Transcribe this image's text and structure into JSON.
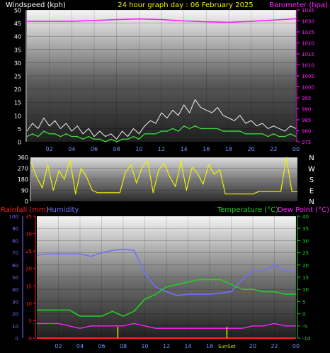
{
  "header": {
    "left_label": "Windspeed (kph)",
    "title": "24 hour graph day : 06 February 2025",
    "right_label": "Barometer (hpa)"
  },
  "colors": {
    "wind_avg": "#3ad53a",
    "wind_gust": "#f0f0f0",
    "barometer": "#ff20ff",
    "wind_dir": "#f0f000",
    "rainfall": "#ff2020",
    "humidity": "#7070ff",
    "temperature": "#20d020",
    "dewpoint": "#ff20ff",
    "sun_marker": "#e0e000",
    "background": "#000000"
  },
  "time_axis": {
    "ticks": [
      "02",
      "04",
      "06",
      "08",
      "10",
      "12",
      "14",
      "16",
      "18",
      "20",
      "22",
      "00"
    ]
  },
  "bottom_header": {
    "rainfall_label": "Rainfall (mm)",
    "humidity_label": "Humidity",
    "temperature_label": "Temperature (°C)",
    "dewpoint_label": "Dew Point (°C)",
    "sunset_label": "SunSet"
  },
  "compass": [
    "N",
    "W",
    "S",
    "E",
    "N"
  ],
  "chart_data": [
    {
      "type": "line",
      "title": "24 hour graph day : 06 February 2025",
      "x_unit": "hours",
      "xlim": [
        0,
        24
      ],
      "y_left": {
        "label": "Windspeed (kph)",
        "ylim": [
          0,
          50
        ],
        "ticks": [
          "0",
          "5",
          "10",
          "15",
          "20",
          "25",
          "30",
          "35",
          "40",
          "45",
          "50"
        ]
      },
      "y_right": {
        "label": "Barometer (hpa)",
        "ylim": [
          975,
          1035
        ],
        "ticks": [
          "975",
          "980",
          "985",
          "990",
          "995",
          "1000",
          "1005",
          "1010",
          "1015",
          "1020",
          "1025",
          "1030",
          "1035"
        ]
      },
      "series": [
        {
          "name": "Wind gust",
          "axis": "left",
          "x": [
            0,
            0.5,
            1,
            1.5,
            2,
            2.5,
            3,
            3.5,
            4,
            4.5,
            5,
            5.5,
            6,
            6.5,
            7,
            7.5,
            8,
            8.5,
            9,
            9.5,
            10,
            10.5,
            11,
            11.5,
            12,
            12.5,
            13,
            13.5,
            14,
            14.5,
            15,
            15.5,
            16,
            16.5,
            17,
            17.5,
            18,
            18.5,
            19,
            19.5,
            20,
            20.5,
            21,
            21.5,
            22,
            22.5,
            23,
            23.5,
            24
          ],
          "values": [
            4,
            7,
            5,
            9,
            6,
            8,
            5,
            7,
            4,
            6,
            3,
            5,
            2,
            4,
            2,
            3,
            1,
            4,
            2,
            5,
            3,
            6,
            8,
            7,
            11,
            9,
            12,
            10,
            14,
            11,
            16,
            13,
            12,
            11,
            13,
            10,
            9,
            8,
            10,
            7,
            8,
            6,
            7,
            5,
            6,
            5,
            4,
            6,
            5
          ]
        },
        {
          "name": "Wind speed",
          "axis": "left",
          "x": [
            0,
            0.5,
            1,
            1.5,
            2,
            2.5,
            3,
            3.5,
            4,
            4.5,
            5,
            5.5,
            6,
            6.5,
            7,
            7.5,
            8,
            8.5,
            9,
            9.5,
            10,
            10.5,
            11,
            11.5,
            12,
            12.5,
            13,
            13.5,
            14,
            14.5,
            15,
            15.5,
            16,
            16.5,
            17,
            17.5,
            18,
            18.5,
            19,
            19.5,
            20,
            20.5,
            21,
            21.5,
            22,
            22.5,
            23,
            23.5,
            24
          ],
          "values": [
            2,
            3,
            2,
            4,
            3,
            3,
            2,
            3,
            2,
            2,
            1,
            2,
            1,
            1,
            0,
            1,
            0,
            1,
            1,
            2,
            1,
            3,
            3,
            3,
            4,
            4,
            5,
            4,
            6,
            5,
            6,
            5,
            5,
            5,
            5,
            4,
            4,
            4,
            4,
            3,
            3,
            3,
            3,
            2,
            3,
            2,
            2,
            3,
            2
          ]
        },
        {
          "name": "Barometer",
          "axis": "right",
          "x": [
            0,
            2,
            4,
            6,
            8,
            10,
            12,
            14,
            16,
            18,
            20,
            22,
            24
          ],
          "values": [
            1029.8,
            1029.8,
            1029.8,
            1030.2,
            1030.6,
            1030.9,
            1030.6,
            1030.0,
            1029.6,
            1029.4,
            1029.8,
            1030.4,
            1031.0
          ]
        }
      ]
    },
    {
      "type": "scatter",
      "title": "",
      "x_unit": "hours",
      "xlim": [
        0,
        24
      ],
      "ylim": [
        0,
        360
      ],
      "y_ticks": [
        "0",
        "90",
        "180",
        "270",
        "360"
      ],
      "series": [
        {
          "name": "Wind direction",
          "x": [
            0,
            0.5,
            1,
            1.5,
            2,
            2.5,
            3,
            3.5,
            4,
            4.5,
            5,
            5.5,
            6,
            6.5,
            7,
            7.5,
            8,
            8.5,
            9,
            9.5,
            10,
            10.5,
            11,
            11.5,
            12,
            12.5,
            13,
            13.5,
            14,
            14.5,
            15,
            15.5,
            16,
            16.5,
            17,
            17.5,
            18,
            18.5,
            19,
            19.5,
            20,
            20.5,
            21,
            21.5,
            22,
            22.5,
            23,
            23.5,
            24
          ],
          "values": [
            320,
            200,
            110,
            300,
            90,
            250,
            180,
            340,
            60,
            270,
            200,
            90,
            70,
            70,
            70,
            70,
            70,
            240,
            300,
            150,
            280,
            330,
            70,
            260,
            310,
            200,
            120,
            330,
            90,
            280,
            230,
            140,
            300,
            220,
            260,
            60,
            60,
            60,
            60,
            60,
            60,
            80,
            80,
            80,
            80,
            80,
            360,
            80,
            80
          ]
        }
      ]
    },
    {
      "type": "line",
      "title": "",
      "x_unit": "hours",
      "xlim": [
        0,
        24
      ],
      "y_humidity": {
        "label": "Humidity",
        "ylim": [
          0,
          100
        ],
        "ticks": [
          "0",
          "10",
          "20",
          "30",
          "40",
          "50",
          "60",
          "70",
          "80",
          "90",
          "100"
        ]
      },
      "y_rain": {
        "label": "Rainfall (mm)",
        "ylim": [
          0,
          35
        ],
        "ticks": [
          "0",
          "5",
          "10",
          "15",
          "20",
          "25",
          "30",
          "35"
        ]
      },
      "y_temp": {
        "label": "Temperature (°C)",
        "ylim": [
          -10,
          40
        ],
        "ticks": [
          "-10",
          "-5",
          "0",
          "5",
          "10",
          "15",
          "20",
          "25",
          "30",
          "35",
          "40"
        ]
      },
      "series": [
        {
          "name": "Humidity",
          "axis": "humidity",
          "x": [
            0,
            1,
            2,
            3,
            4,
            5,
            6,
            7,
            8,
            9,
            10,
            11,
            12,
            13,
            14,
            15,
            16,
            17,
            18,
            19,
            20,
            21,
            22,
            23,
            24
          ],
          "values": [
            68,
            69,
            69,
            69,
            69,
            67,
            70,
            72,
            73,
            72,
            53,
            42,
            38,
            35,
            36,
            36,
            36,
            37,
            38,
            48,
            55,
            55,
            60,
            55,
            55
          ]
        },
        {
          "name": "Temperature",
          "axis": "temp",
          "x": [
            0,
            1,
            2,
            3,
            4,
            5,
            6,
            7,
            8,
            9,
            10,
            11,
            12,
            13,
            14,
            15,
            16,
            17,
            18,
            19,
            20,
            21,
            22,
            23,
            24
          ],
          "values": [
            1.5,
            1.5,
            1.5,
            1.5,
            -1,
            -1,
            -1,
            1,
            -1,
            1,
            6,
            8,
            11,
            12,
            13,
            14,
            14,
            14,
            12,
            10,
            10,
            9,
            9,
            8,
            8
          ]
        },
        {
          "name": "Dew Point",
          "axis": "temp",
          "x": [
            0,
            1,
            2,
            3,
            4,
            5,
            6,
            7,
            8,
            9,
            10,
            11,
            12,
            13,
            14,
            15,
            16,
            17,
            18,
            19,
            20,
            21,
            22,
            23,
            24
          ],
          "values": [
            -4,
            -4,
            -4,
            -5,
            -6,
            -5,
            -5,
            -5,
            -5,
            -4,
            -5,
            -6,
            -6,
            -6,
            -6,
            -6,
            -6,
            -6,
            -6,
            -6,
            -5,
            -5,
            -4,
            -5,
            -5
          ]
        },
        {
          "name": "Rainfall",
          "axis": "rain",
          "x": [
            0,
            24
          ],
          "values": [
            0,
            0
          ]
        }
      ],
      "markers": [
        {
          "name": "Sunrise",
          "x": 7.5
        },
        {
          "name": "Sunset",
          "x": 17.6
        }
      ]
    }
  ]
}
